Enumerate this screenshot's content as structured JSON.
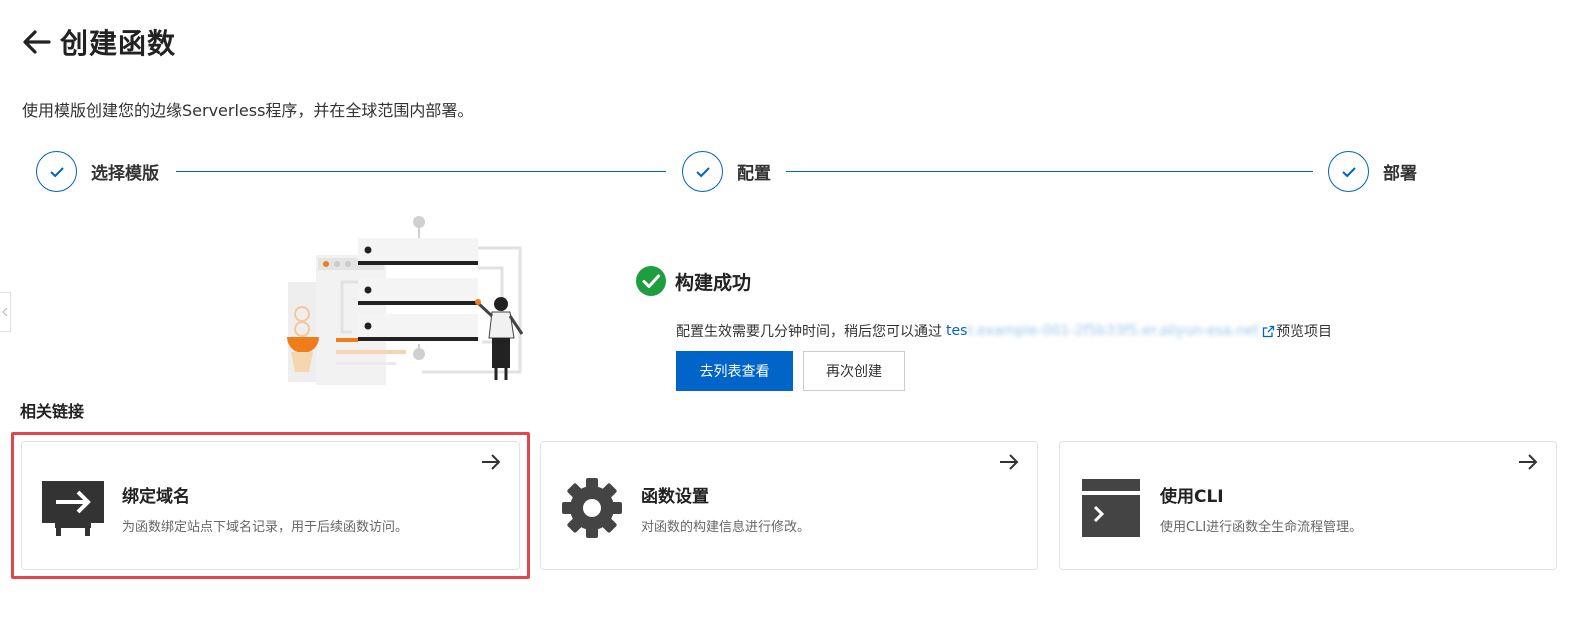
{
  "header": {
    "title": "创建函数",
    "back_icon": "arrow-left-icon"
  },
  "description": "使用模版创建您的边缘Serverless程序，并在全球范围内部署。",
  "steps": [
    {
      "label": "选择模版",
      "status": "done"
    },
    {
      "label": "配置",
      "status": "done"
    },
    {
      "label": "部署",
      "status": "done"
    }
  ],
  "result": {
    "title": "构建成功",
    "message_prefix": "配置生效需要几分钟时间，稍后您可以通过",
    "domain_visible": "tes",
    "domain_blurred": "t.example-001-2f5b33f5.er.aliyun-esa.net",
    "message_suffix": "预览项目",
    "primary_button": "去列表查看",
    "secondary_button": "再次创建"
  },
  "related": {
    "title": "相关链接",
    "cards": [
      {
        "title": "绑定域名",
        "desc": "为函数绑定站点下域名记录，用于后续函数访问。",
        "icon": "monitor-arrow-icon"
      },
      {
        "title": "函数设置",
        "desc": "对函数的构建信息进行修改。",
        "icon": "gear-icon"
      },
      {
        "title": "使用CLI",
        "desc": "使用CLI进行函数全生命流程管理。",
        "icon": "terminal-icon"
      }
    ]
  },
  "colors": {
    "accent": "#0064c8",
    "success": "#1e9e3f",
    "highlight": "#e0474c",
    "illustration_orange": "#f07c1a"
  }
}
